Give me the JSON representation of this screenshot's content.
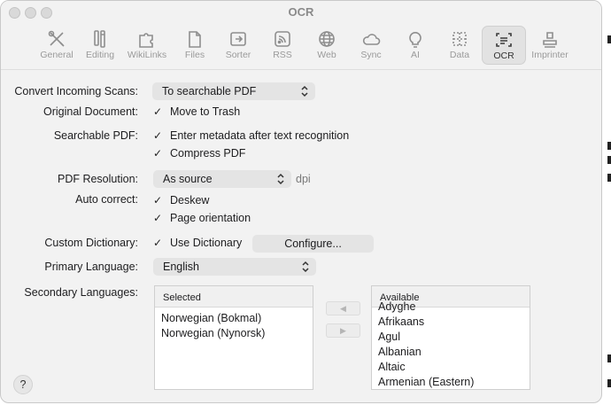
{
  "window": {
    "title": "OCR"
  },
  "toolbar": {
    "items": [
      {
        "label": "General",
        "icon": "tools-icon"
      },
      {
        "label": "Editing",
        "icon": "pencil-icon"
      },
      {
        "label": "WikiLinks",
        "icon": "puzzle-icon"
      },
      {
        "label": "Files",
        "icon": "files-icon"
      },
      {
        "label": "Sorter",
        "icon": "sorter-icon"
      },
      {
        "label": "RSS",
        "icon": "rss-icon"
      },
      {
        "label": "Web",
        "icon": "globe-icon"
      },
      {
        "label": "Sync",
        "icon": "cloud-icon"
      },
      {
        "label": "AI",
        "icon": "lightbulb-icon"
      },
      {
        "label": "Data",
        "icon": "data-icon"
      },
      {
        "label": "OCR",
        "icon": "ocr-scan-icon"
      },
      {
        "label": "Imprinter",
        "icon": "stamp-icon"
      }
    ],
    "selected": "OCR"
  },
  "form": {
    "convert_incoming": {
      "label": "Convert Incoming Scans:",
      "value": "To searchable PDF"
    },
    "original_document": {
      "label": "Original Document:",
      "option": "Move to Trash",
      "checked": true
    },
    "searchable_pdf": {
      "label": "Searchable PDF:",
      "options": [
        {
          "text": "Enter metadata after text recognition",
          "checked": true
        },
        {
          "text": "Compress PDF",
          "checked": true
        }
      ]
    },
    "pdf_resolution": {
      "label": "PDF Resolution:",
      "value": "As source",
      "unit": "dpi"
    },
    "auto_correct": {
      "label": "Auto correct:",
      "options": [
        {
          "text": "Deskew",
          "checked": true
        },
        {
          "text": "Page orientation",
          "checked": true
        }
      ]
    },
    "custom_dictionary": {
      "label": "Custom Dictionary:",
      "option": "Use Dictionary",
      "checked": true,
      "button": "Configure..."
    },
    "primary_language": {
      "label": "Primary Language:",
      "value": "English"
    },
    "secondary_languages": {
      "label": "Secondary Languages:",
      "selected_header": "Selected",
      "selected": [
        "Norwegian (Bokmal)",
        "Norwegian (Nynorsk)"
      ],
      "available_header": "Available",
      "available": [
        "Adyghe",
        "Afrikaans",
        "Agul",
        "Albanian",
        "Altaic",
        "Armenian (Eastern)"
      ],
      "add_arrow": "◀",
      "remove_arrow": "▶"
    }
  },
  "help": {
    "label": "?"
  },
  "colors": {
    "window_bg": "#f2f2f2",
    "control_bg": "#e4e4e4",
    "active_tab": "#e2e2e2",
    "muted_text": "#9a9a9a"
  }
}
